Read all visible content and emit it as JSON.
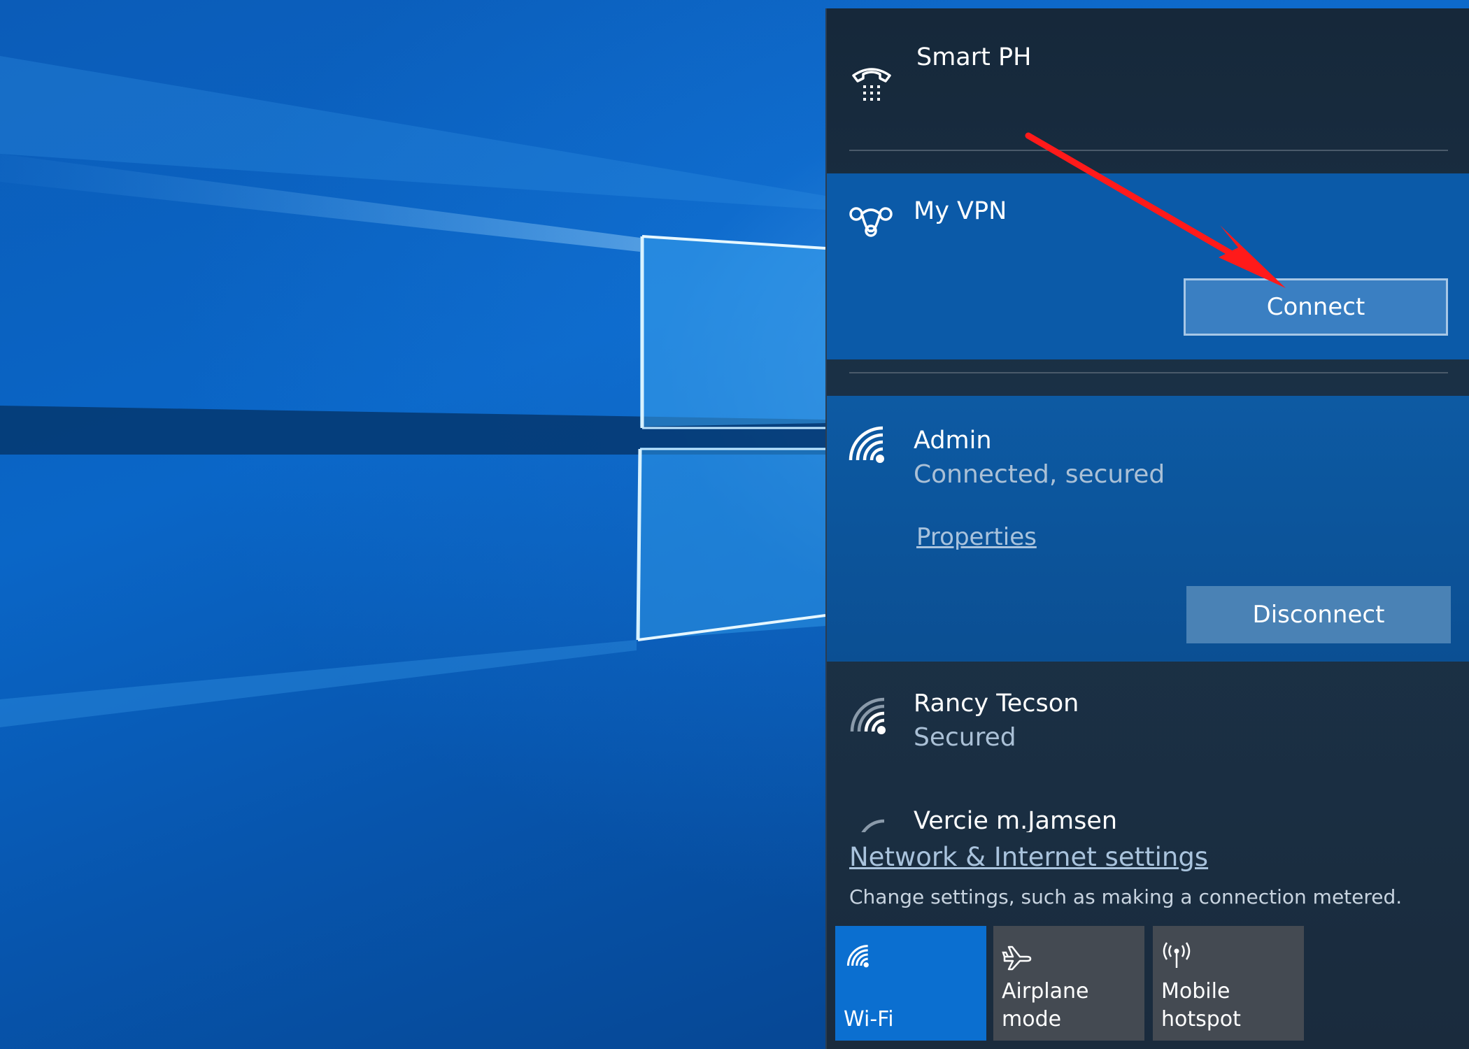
{
  "networks": {
    "smartph": {
      "name": "Smart PH",
      "icon": "dialup-phone-icon"
    },
    "vpn": {
      "name": "My VPN",
      "icon": "vpn-icon",
      "button": "Connect"
    },
    "admin": {
      "name": "Admin",
      "status": "Connected, secured",
      "link": "Properties",
      "button": "Disconnect",
      "icon": "wifi-full-icon"
    },
    "rancy": {
      "name": "Rancy Tecson",
      "status": "Secured",
      "icon": "wifi-icon"
    },
    "vercie": {
      "name": "Vercie m.Jamsen",
      "icon": "wifi-icon"
    }
  },
  "settings": {
    "link": "Network & Internet settings",
    "description": "Change settings, such as making a connection metered."
  },
  "quick_actions": [
    {
      "label": "Wi-Fi",
      "icon": "wifi-icon",
      "active": true
    },
    {
      "label": "Airplane mode",
      "icon": "airplane-icon",
      "active": false
    },
    {
      "label": "Mobile\nhotspot",
      "icon": "hotspot-icon",
      "active": false
    }
  ],
  "colors": {
    "accent": "#0b6fd0",
    "vpn_highlight": "#0b5aa8",
    "annotation": "#ff1a1a"
  }
}
